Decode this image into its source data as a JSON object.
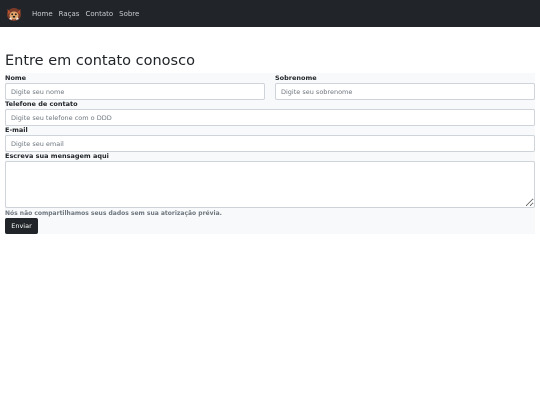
{
  "nav": {
    "logo": "dog-logo-icon",
    "links": [
      "Home",
      "Raças",
      "Contato",
      "Sobre"
    ]
  },
  "page": {
    "title": "Entre em contato conosco"
  },
  "form": {
    "nome": {
      "label": "Nome",
      "placeholder": "Digite seu nome",
      "value": ""
    },
    "sobrenome": {
      "label": "Sobrenome",
      "placeholder": "Digite seu sobrenome",
      "value": ""
    },
    "telefone": {
      "label": "Telefone de contato",
      "placeholder": "Digite seu telefone com o DDD",
      "value": ""
    },
    "email": {
      "label": "E-mail",
      "placeholder": "Digite seu email",
      "value": ""
    },
    "mensagem": {
      "label": "Escreva sua mensagem aqui",
      "placeholder": "",
      "value": ""
    },
    "privacy_note": "Nós não compartilhamos seus dados sem sua atorização prévia.",
    "submit_label": "Enviar"
  },
  "colors": {
    "navbar": "#212529",
    "form_background": "#f8f9fa",
    "button": "#212529"
  }
}
